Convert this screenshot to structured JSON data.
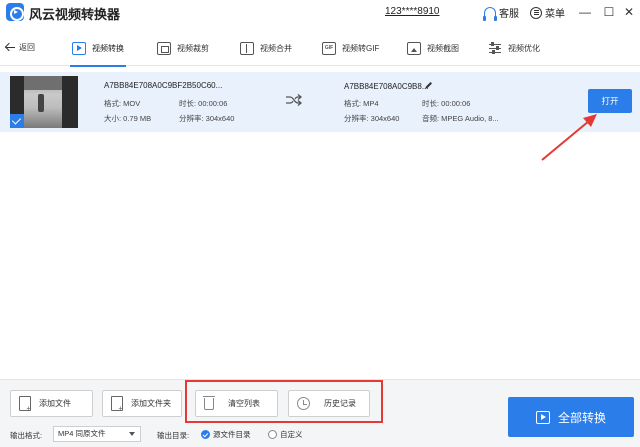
{
  "titlebar": {
    "app_title": "风云视频转换器",
    "user_id": "123****8910",
    "support_label": "客服",
    "menu_label": "菜单"
  },
  "toolbar": {
    "back_label": "返回",
    "tabs": [
      {
        "label": "视频转换",
        "icon": "convert-icon",
        "active": true
      },
      {
        "label": "视频裁剪",
        "icon": "crop-icon"
      },
      {
        "label": "视频合并",
        "icon": "merge-icon"
      },
      {
        "label": "视频转GIF",
        "icon": "gif-icon"
      },
      {
        "label": "视频截图",
        "icon": "screenshot-icon"
      },
      {
        "label": "视频优化",
        "icon": "optimize-icon"
      }
    ]
  },
  "file": {
    "source": {
      "name": "A7BB84E708A0C9BF2B50C60...",
      "format": "格式: MOV",
      "duration": "时长: 00:00:06",
      "size": "大小: 0.79 MB",
      "resolution": "分辨率: 304x640"
    },
    "output": {
      "name": "A7BB84E708A0C9B8...",
      "format": "格式: MP4",
      "duration": "时长: 00:00:06",
      "resolution": "分辨率: 304x640",
      "audio": "音频: MPEG Audio, 8..."
    },
    "open_label": "打开"
  },
  "bottom": {
    "add_file": "添加文件",
    "add_folder": "添加文件夹",
    "clear_list": "清空列表",
    "history": "历史记录",
    "format_label": "输出格式:",
    "format_value": "MP4 同原文件",
    "dir_label": "输出目录:",
    "dir_source": "源文件目录",
    "dir_custom": "自定义",
    "convert_all": "全部转换"
  },
  "colors": {
    "accent": "#2b7de9",
    "highlight_row": "#e9f2fc",
    "annotation": "#e53935"
  }
}
